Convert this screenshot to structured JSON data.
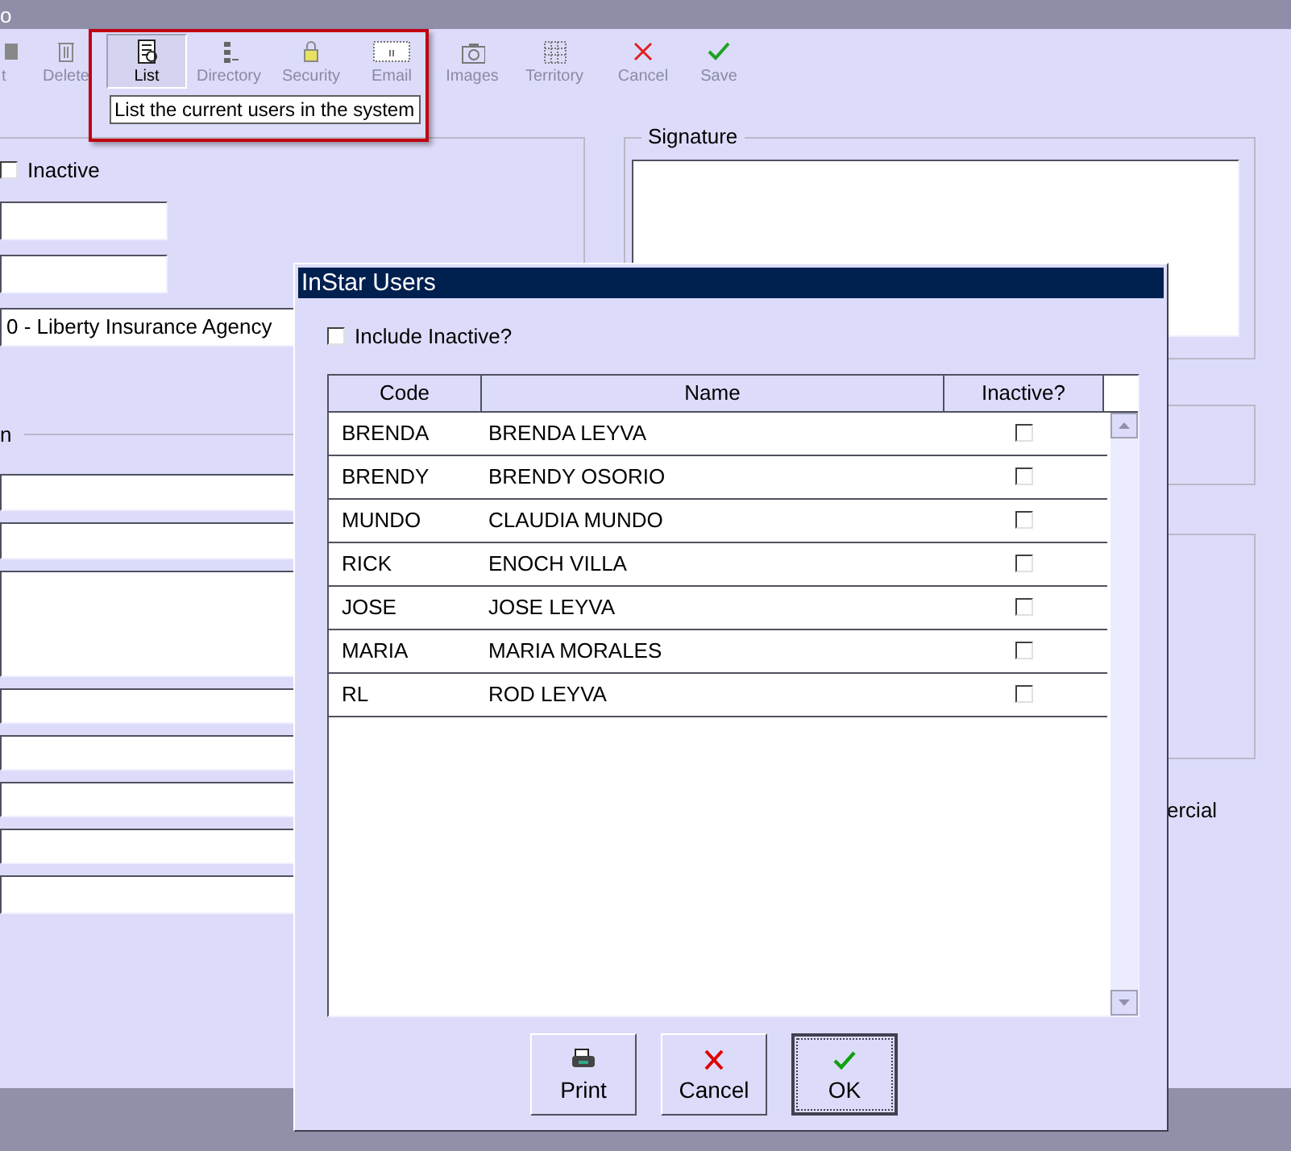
{
  "window": {
    "title": "o"
  },
  "toolbar": [
    {
      "label": "t",
      "kind": "edit",
      "disabled": true,
      "pressed": false
    },
    {
      "label": "Delete",
      "kind": "delete",
      "disabled": true,
      "pressed": false
    },
    {
      "label": "List",
      "kind": "list",
      "disabled": false,
      "pressed": true
    },
    {
      "label": "Directory",
      "kind": "directory",
      "disabled": true,
      "pressed": false
    },
    {
      "label": "Security",
      "kind": "security",
      "disabled": true,
      "pressed": false
    },
    {
      "label": "Email",
      "kind": "email",
      "disabled": true,
      "pressed": false
    },
    {
      "label": "Images",
      "kind": "images",
      "disabled": true,
      "pressed": false
    },
    {
      "label": "Territory",
      "kind": "territory",
      "disabled": true,
      "pressed": false
    },
    {
      "label": "Cancel",
      "kind": "cancel",
      "disabled": true,
      "pressed": false
    },
    {
      "label": "Save",
      "kind": "save",
      "disabled": true,
      "pressed": false
    }
  ],
  "tooltip": "List the current users in the system",
  "form": {
    "inactive": {
      "label": "Inactive",
      "checked": false
    },
    "agency": "0 - Liberty Insurance Agency",
    "section_label": "n",
    "signature_label": "Signature",
    "partial_label": "ercial"
  },
  "dialog": {
    "title": "InStar Users",
    "include_inactive": {
      "label": "Include Inactive?",
      "checked": false
    },
    "columns": [
      "Code",
      "Name",
      "Inactive?"
    ],
    "rows": [
      {
        "code": "BRENDA",
        "name": "BRENDA LEYVA",
        "inactive": false
      },
      {
        "code": "BRENDY",
        "name": "BRENDY OSORIO",
        "inactive": false
      },
      {
        "code": "MUNDO",
        "name": "CLAUDIA MUNDO",
        "inactive": false
      },
      {
        "code": "RICK",
        "name": "ENOCH VILLA",
        "inactive": false
      },
      {
        "code": "JOSE",
        "name": "JOSE LEYVA",
        "inactive": false
      },
      {
        "code": "MARIA",
        "name": "MARIA MORALES",
        "inactive": false
      },
      {
        "code": "RL",
        "name": "ROD LEYVA",
        "inactive": false
      }
    ],
    "buttons": [
      {
        "label": "Print",
        "kind": "print",
        "default": false
      },
      {
        "label": "Cancel",
        "kind": "cancel",
        "default": false
      },
      {
        "label": "OK",
        "kind": "ok",
        "default": true
      }
    ]
  }
}
